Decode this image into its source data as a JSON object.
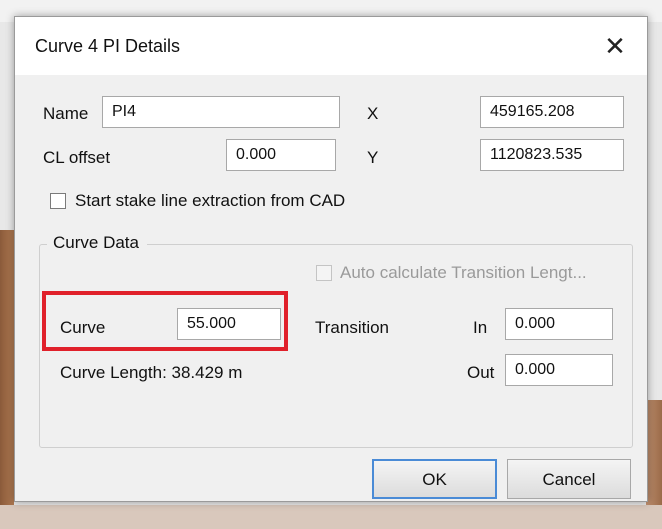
{
  "dialog": {
    "title": "Curve 4 PI Details",
    "close_glyph": "✕"
  },
  "fields": {
    "name_label": "Name",
    "name_value": "PI4",
    "x_label": "X",
    "x_value": "459165.208",
    "cl_offset_label": "CL offset",
    "cl_offset_value": "0.000",
    "y_label": "Y",
    "y_value": "1120823.535"
  },
  "stake_line_checkbox": {
    "label": "Start stake line extraction from CAD",
    "checked": false
  },
  "curve_data": {
    "group_label": "Curve Data",
    "auto_calc_label": "Auto calculate Transition Lengt...",
    "auto_calc_checked": false,
    "curve_label": "Curve",
    "curve_value": "55.000",
    "transition_label": "Transition",
    "in_label": "In",
    "in_value": "0.000",
    "out_label": "Out",
    "out_value": "0.000",
    "curve_length_text": "Curve Length: 38.429 m"
  },
  "buttons": {
    "ok": "OK",
    "cancel": "Cancel"
  },
  "colors": {
    "highlight": "#e0202a",
    "default_button_border": "#4a8bd6"
  }
}
